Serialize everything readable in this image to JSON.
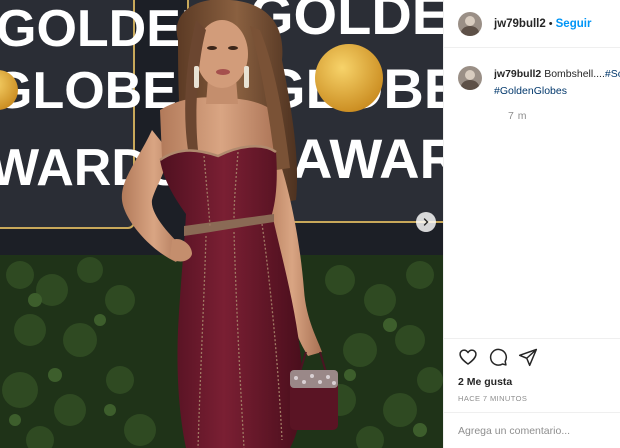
{
  "photo": {
    "banner_lines": [
      "GOLDEN",
      "GLOBE",
      "AWARDS"
    ],
    "left_banner_lines": [
      "GOLDEN",
      "GLOBE",
      "WARDS"
    ],
    "next_icon": "chevron-right-icon"
  },
  "header": {
    "username": "jw79bull2",
    "separator": "•",
    "follow_label": "Seguir"
  },
  "caption": {
    "username": "jw79bull2",
    "text": "Bombshell....",
    "hashtags": [
      "#So",
      "#GoldenGlobes"
    ],
    "time": "7 m"
  },
  "actions": {
    "icons": [
      "heart-icon",
      "comment-icon",
      "share-icon"
    ],
    "likes": "2 Me gusta",
    "time_ago": "HACE 7 MINUTOS"
  },
  "comment": {
    "placeholder": "Agrega un comentario..."
  },
  "colors": {
    "link_blue": "#0095f6",
    "hashtag": "#00376b",
    "muted": "#8e8e8e",
    "dress": "#6e1a2c"
  }
}
